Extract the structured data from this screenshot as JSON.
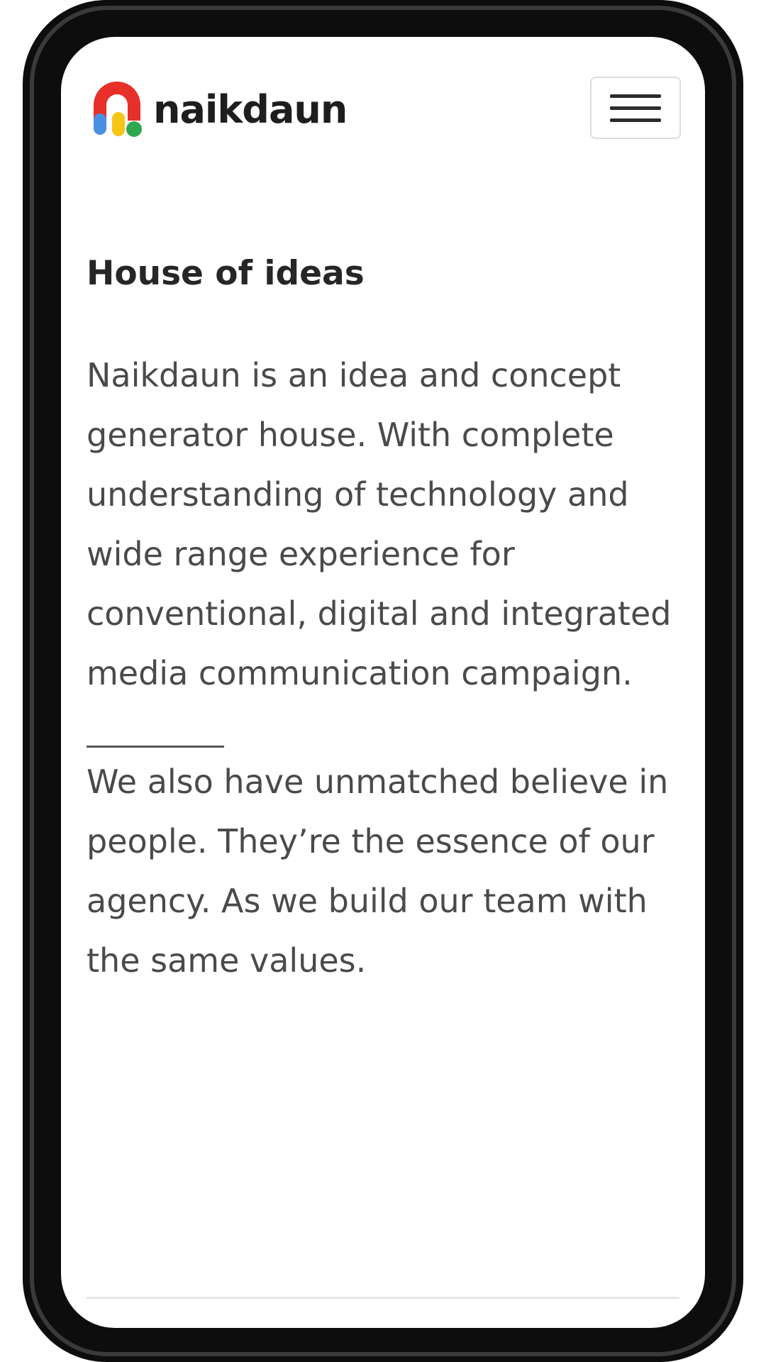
{
  "brand": {
    "name": "naikdaun",
    "colors": {
      "red": "#e7302a",
      "yellow": "#f5c518",
      "blue": "#4a90e2",
      "green": "#2ea84f"
    }
  },
  "header": {
    "menu_icon": "hamburger-icon"
  },
  "main": {
    "title": "House of ideas",
    "paragraph_1": "Naikdaun is an idea and concept generator house. With complete understanding of technology and wide range experience for conventional, digital and integrated media communication campaign.",
    "paragraph_2": "We also have unmatched believe in people. They’re the essence of our agency. As we build our team with the same values."
  }
}
